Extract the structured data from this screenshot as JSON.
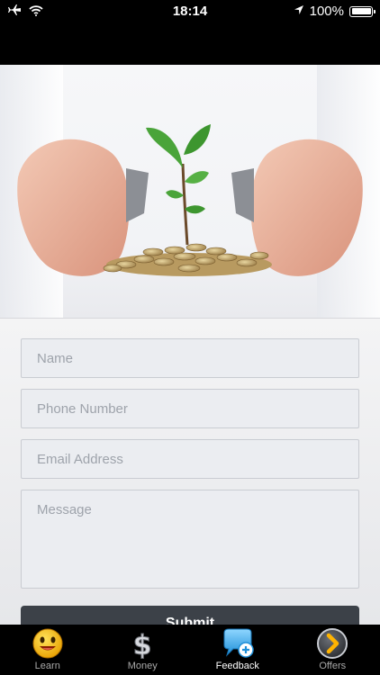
{
  "status_bar": {
    "time": "18:14",
    "battery": "100%",
    "icons": [
      "airplane-icon",
      "wifi-icon",
      "location-arrow-icon",
      "battery-icon"
    ]
  },
  "hero": {
    "image": "hands protecting a sapling growing from a pile of coins"
  },
  "form": {
    "name_placeholder": "Name",
    "phone_placeholder": "Phone Number",
    "email_placeholder": "Email Address",
    "message_placeholder": "Message",
    "submit_label": "Submit"
  },
  "tab_bar": {
    "active": "Feedback",
    "tabs": [
      {
        "label": "Learn",
        "icon": "smiley-face-icon"
      },
      {
        "label": "Money",
        "icon": "dollar-sign-icon"
      },
      {
        "label": "Feedback",
        "icon": "chat-bubble-plus-icon"
      },
      {
        "label": "Offers",
        "icon": "chevron-right-circle-icon"
      }
    ]
  },
  "colors": {
    "bar_background": "#000000",
    "field_background": "#ebedf1",
    "button_background": "#3c4148",
    "active_tab": "#ffffff",
    "inactive_tab": "#a9a9a9"
  }
}
